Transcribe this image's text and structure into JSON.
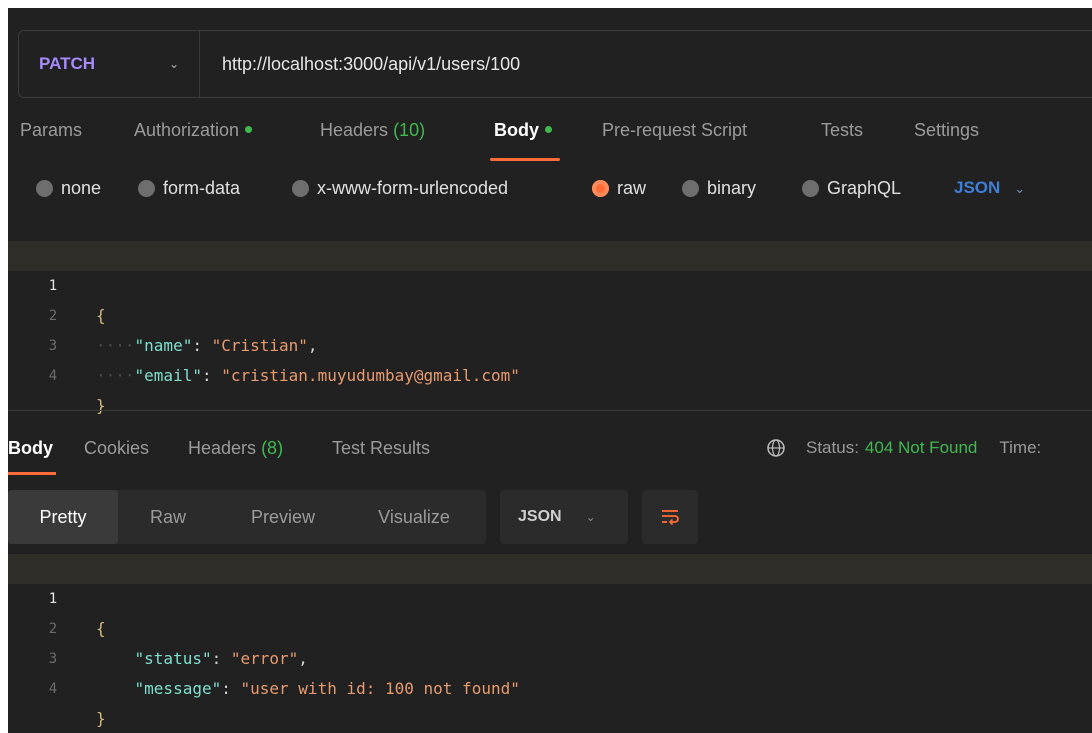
{
  "request": {
    "method": "PATCH",
    "url": "http://localhost:3000/api/v1/users/100"
  },
  "req_tabs": {
    "params": "Params",
    "authorization": "Authorization",
    "headers": "Headers",
    "headers_count": "(10)",
    "body": "Body",
    "pre_request": "Pre-request Script",
    "tests": "Tests",
    "settings": "Settings"
  },
  "body_types": {
    "none": "none",
    "form_data": "form-data",
    "urlencoded": "x-www-form-urlencoded",
    "raw": "raw",
    "binary": "binary",
    "graphql": "GraphQL",
    "format": "JSON"
  },
  "request_body": {
    "line_numbers": [
      "1",
      "2",
      "3",
      "4"
    ],
    "open": "{",
    "guide": "····",
    "name_key": "\"name\"",
    "name_value": "\"Cristian\"",
    "email_key": "\"email\"",
    "email_value": "\"cristian.muyudumbay@gmail.com\"",
    "close": "}"
  },
  "resp_tabs": {
    "body": "Body",
    "cookies": "Cookies",
    "headers": "Headers",
    "headers_count": "(8)",
    "test_results": "Test Results"
  },
  "status": {
    "label": "Status:",
    "value": "404 Not Found",
    "time_label": "Time:",
    "status_color": "#3fb950"
  },
  "view_modes": {
    "pretty": "Pretty",
    "raw": "Raw",
    "preview": "Preview",
    "visualize": "Visualize",
    "format": "JSON"
  },
  "response_body": {
    "line_numbers": [
      "1",
      "2",
      "3",
      "4"
    ],
    "open": "{",
    "status_key": "\"status\"",
    "status_value": "\"error\"",
    "message_key": "\"message\"",
    "message_value": "\"user with id: 100 not found\"",
    "close": "}"
  },
  "icons": {
    "method_chevron": "chevron-down-icon",
    "globe": "globe-icon",
    "wrap": "wrap-lines-icon"
  },
  "colors": {
    "accent": "#ff6c37",
    "method": "#a78bfa",
    "success": "#3fb950",
    "link": "#3f7fd8"
  }
}
